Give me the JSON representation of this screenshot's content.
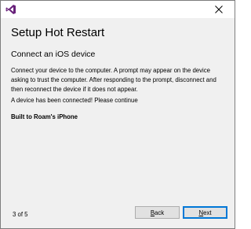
{
  "window": {
    "app_icon": "visual-studio-icon",
    "close_icon": "close-icon"
  },
  "wizard": {
    "title": "Setup Hot Restart",
    "section_heading": "Connect an iOS device",
    "instructions": "Connect your device to the computer. A prompt may appear on the device asking to trust the computer. After responding to the prompt, disconnect and then reconnect the device if it does not appear.",
    "status": "A device has been connected! Please continue",
    "built_to": "Built to Roam's iPhone",
    "step": "3 of 5"
  },
  "buttons": {
    "back": {
      "accel": "B",
      "rest": "ack"
    },
    "next": {
      "accel": "N",
      "rest": "ext"
    }
  },
  "colors": {
    "accent": "#0078d7",
    "vs_purple": "#68217a",
    "dialog_bg": "#f0f0f0"
  }
}
